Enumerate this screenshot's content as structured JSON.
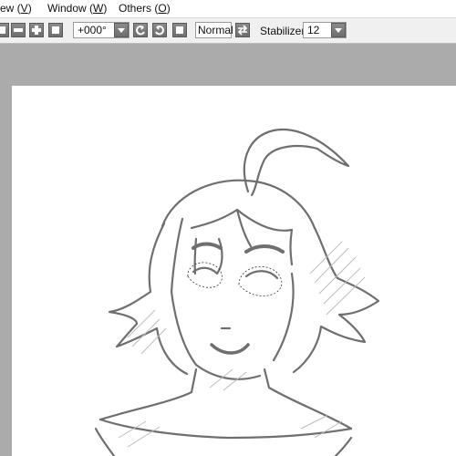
{
  "menubar": {
    "items": [
      {
        "label_prefix": "ew (",
        "accel": "V",
        "label_suffix": ")"
      },
      {
        "label_prefix": "Window (",
        "accel": "W",
        "label_suffix": ")"
      },
      {
        "label_prefix": "Others (",
        "accel": "O",
        "label_suffix": ")"
      }
    ]
  },
  "toolbar": {
    "rotation_value": "+000°",
    "blend_mode": "Normal",
    "stabilizer_label": "Stabilizer",
    "stabilizer_value": "12",
    "icons": [
      "zoom-out-icon",
      "zoom-in-icon",
      "fit-icon",
      "rotate-left-icon",
      "rotate-right-icon",
      "reset-rotation-icon",
      "flip-icon",
      "dropdown-arrow-icon"
    ]
  },
  "colors": {
    "workspace_bg": "#ababab",
    "paper": "#ffffff",
    "line_art": "#707070",
    "button": "#7a7a7a"
  }
}
